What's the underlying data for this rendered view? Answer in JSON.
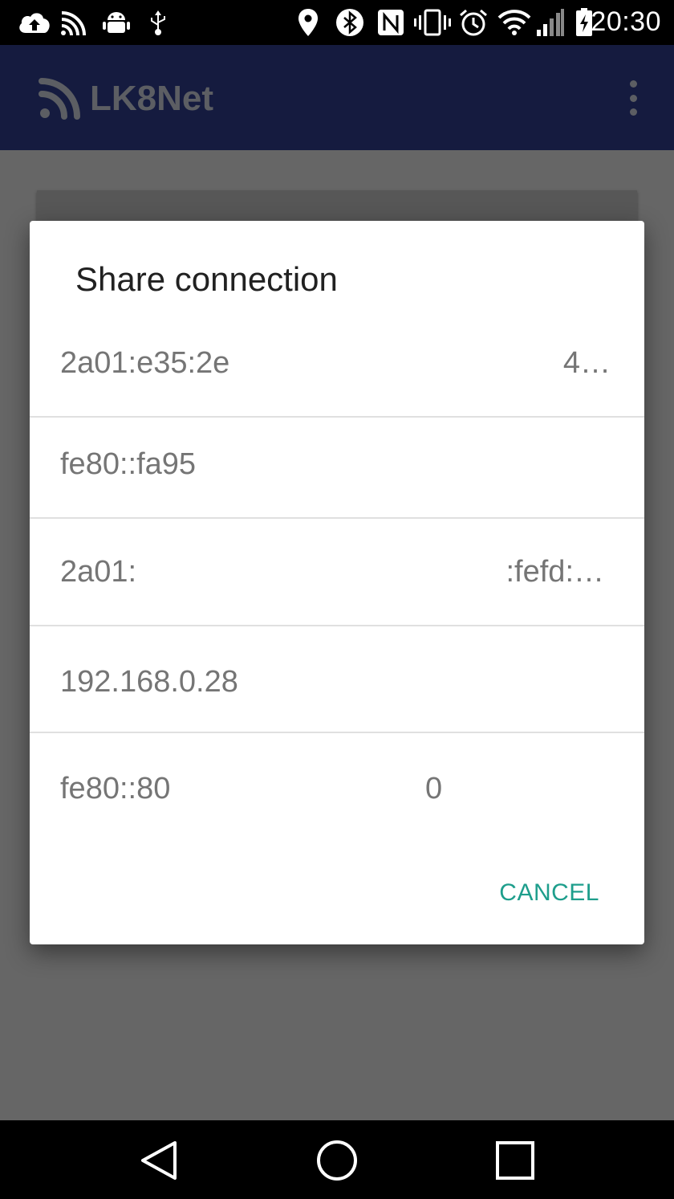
{
  "status_bar": {
    "time": "20:30",
    "icons": [
      "cloud-upload-icon",
      "cast-icon",
      "android-debug-icon",
      "usb-icon",
      "location-icon",
      "bluetooth-icon",
      "nfc-icon",
      "vibrate-icon",
      "alarm-icon",
      "wifi-icon",
      "signal-icon",
      "battery-charging-icon"
    ]
  },
  "app_bar": {
    "title": "LK8Net",
    "logo_icon": "rss-feed-icon",
    "menu_icon": "more-vert-icon"
  },
  "dialog": {
    "title": "Share connection",
    "items": [
      {
        "left": "2a01:e35:2e",
        "right": "4…"
      },
      {
        "left": "fe80::fa95",
        "right": ""
      },
      {
        "left": "2a01:",
        "right": ":fefd:…"
      },
      {
        "left": "192.168.0.28",
        "right": ""
      },
      {
        "left": "fe80::80",
        "right": "0"
      }
    ],
    "cancel_label": "CANCEL",
    "accent_color": "#1e9e8c"
  },
  "nav_bar": {
    "buttons": [
      "back-icon",
      "home-icon",
      "recents-icon"
    ]
  }
}
